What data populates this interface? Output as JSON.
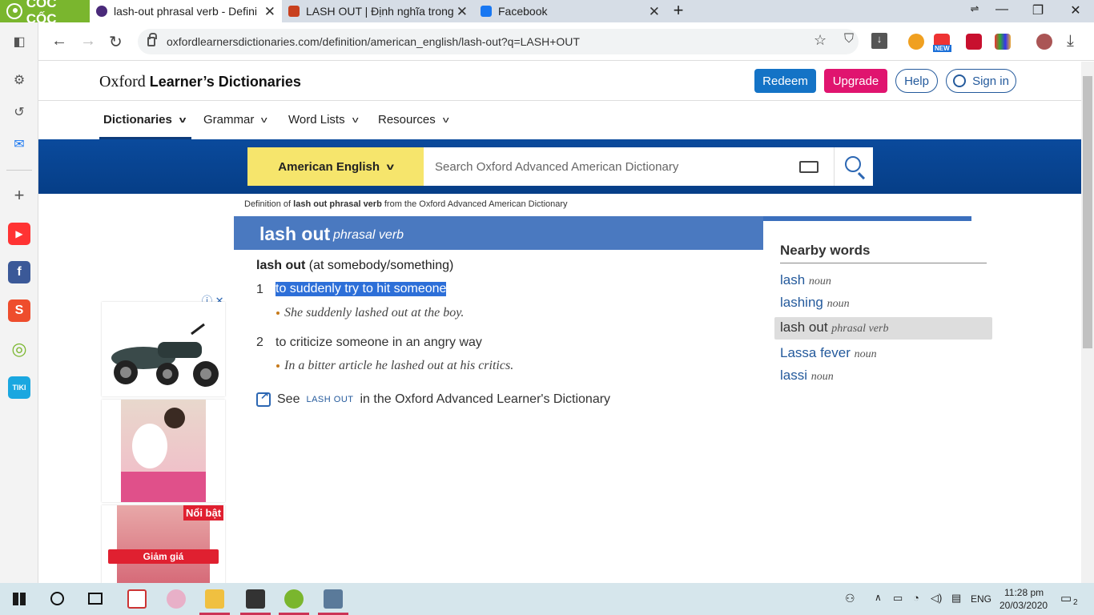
{
  "browser": {
    "brand": "CỐC CỐC",
    "tabs": [
      {
        "title": "lash-out phrasal verb - Defini",
        "active": true
      },
      {
        "title": "LASH OUT | Định nghĩa trong",
        "active": false
      },
      {
        "title": "Facebook",
        "active": false
      }
    ],
    "url": "oxfordlearnersdictionaries.com/definition/american_english/lash-out?q=LASH+OUT",
    "new_badge": "NEW"
  },
  "site": {
    "logo_oxford": "Oxford",
    "logo_rest": "Learner’s Dictionaries",
    "buttons": {
      "redeem": "Redeem",
      "upgrade": "Upgrade",
      "help": "Help",
      "signin": "Sign in"
    },
    "menu": [
      "Dictionaries",
      "Grammar",
      "Word Lists",
      "Resources"
    ]
  },
  "search": {
    "dictionary": "American English",
    "placeholder": "Search Oxford Advanced American Dictionary"
  },
  "entry": {
    "crumb_prefix": "Definition of ",
    "crumb_bold": "lash out phrasal verb",
    "crumb_suffix": " from the Oxford Advanced American Dictionary",
    "headword": "lash out",
    "pos": "phrasal verb",
    "phrase": "lash out",
    "phrase_args": " (at somebody/something)",
    "senses": [
      {
        "num": "1",
        "def": "to suddenly try to hit someone",
        "example": "She suddenly lashed out at the boy."
      },
      {
        "num": "2",
        "def": "to criticize someone in an angry way",
        "example": "In a bitter article he lashed out at his critics."
      }
    ],
    "see_prefix": "See",
    "see_term": "LASH OUT",
    "see_suffix": "in the Oxford Advanced Learner's Dictionary"
  },
  "nearby": {
    "title": "Nearby words",
    "words": [
      {
        "word": "lash",
        "pos": "noun"
      },
      {
        "word": "lashing",
        "pos": "noun"
      },
      {
        "word": "lash out",
        "pos": "phrasal verb"
      },
      {
        "word": "Lassa fever",
        "pos": "noun"
      },
      {
        "word": "lassi",
        "pos": "noun"
      }
    ]
  },
  "ads": {
    "badge": "Nổi bật",
    "sale": "Giảm giá"
  },
  "taskbar": {
    "lang": "ENG",
    "time": "11:28 pm",
    "date": "20/03/2020",
    "notifications": "2"
  },
  "colors": {
    "brand_green": "#7ab62e",
    "oxford_blue": "#0a4a9c",
    "redeem": "#1473c6",
    "upgrade": "#e0146f",
    "dict_yellow": "#f6e56c",
    "headword_band": "#4a79c0"
  }
}
